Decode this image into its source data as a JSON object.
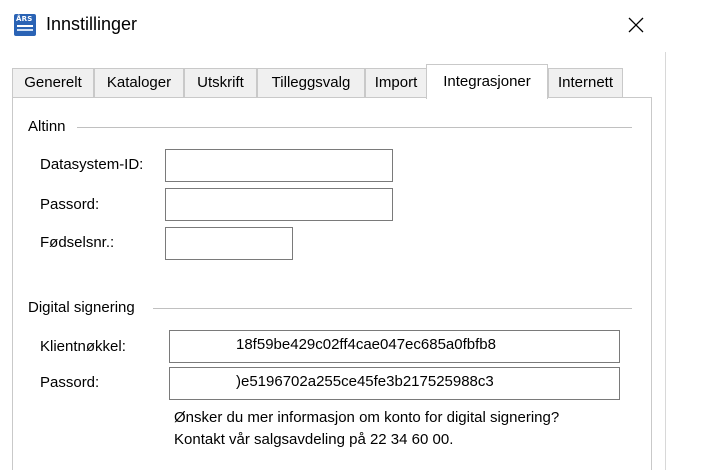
{
  "window": {
    "title": "Innstillinger",
    "icon_text": "ÅRS",
    "close_icon": "close-icon"
  },
  "tabs": [
    {
      "label": "Generelt",
      "active": false
    },
    {
      "label": "Kataloger",
      "active": false
    },
    {
      "label": "Utskrift",
      "active": false
    },
    {
      "label": "Tilleggsvalg",
      "active": false
    },
    {
      "label": "Import",
      "active": false
    },
    {
      "label": "Integrasjoner",
      "active": true
    },
    {
      "label": "Internett",
      "active": false
    }
  ],
  "altinn": {
    "group_title": "Altinn",
    "datasystem_label": "Datasystem-ID:",
    "datasystem_value": "",
    "passord_label": "Passord:",
    "passord_value": "",
    "fodselsnr_label": "Fødselsnr.:",
    "fodselsnr_value": ""
  },
  "digital_signering": {
    "group_title": "Digital signering",
    "klientnokkel_label": "Klientnøkkel:",
    "klientnokkel_value": "18f59be429c02ff4cae047ec685a0fbfb8",
    "passord_label": "Passord:",
    "passord_value": ")e5196702a255ce45fe3b217525988c3",
    "info_line1": "Ønsker du mer informasjon om konto for digital signering?",
    "info_line2": "Kontakt vår salgsavdeling på 22 34 60 00."
  }
}
